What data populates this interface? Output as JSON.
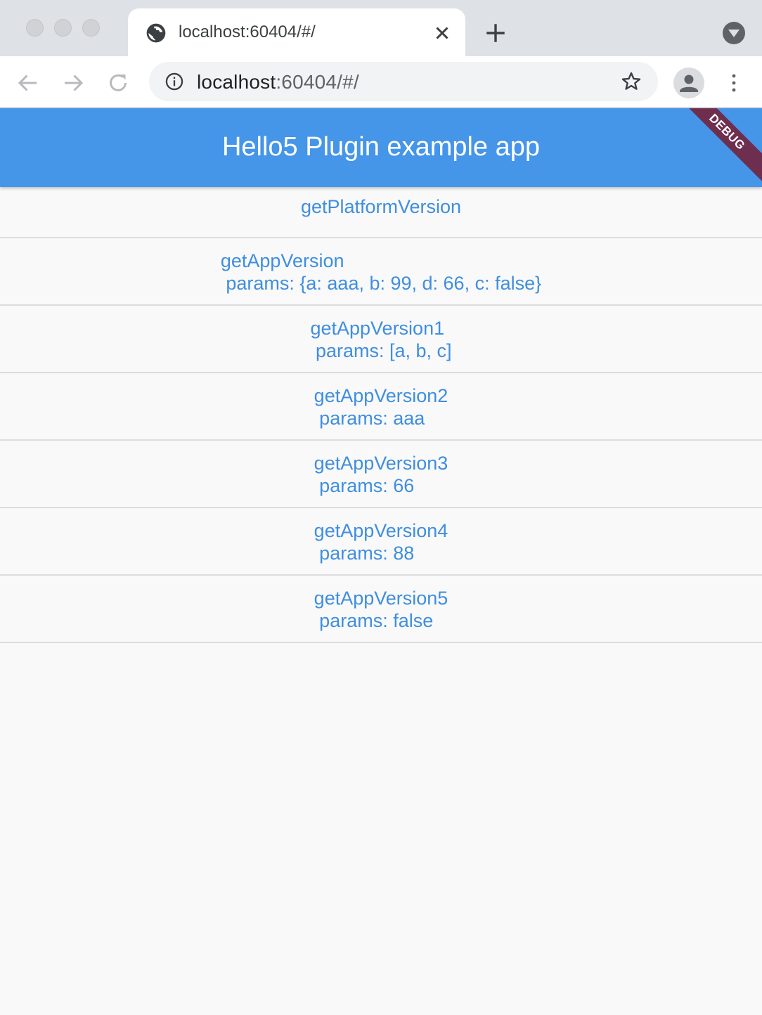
{
  "browser": {
    "tab": {
      "title": "localhost:60404/#/"
    },
    "address": {
      "host": "localhost",
      "rest": ":60404/#/"
    }
  },
  "app": {
    "title": "Hello5 Plugin example app",
    "debug_label": "DEBUG"
  },
  "items": [
    {
      "label": "getPlatformVersion"
    },
    {
      "label": "getAppVersion\n params: {a: aaa, b: 99, d: 66, c: false}"
    },
    {
      "label": "getAppVersion1\n params: [a, b, c]"
    },
    {
      "label": "getAppVersion2\n params: aaa"
    },
    {
      "label": "getAppVersion3\n params: 66"
    },
    {
      "label": "getAppVersion4\n params: 88"
    },
    {
      "label": "getAppVersion5\n params: false"
    }
  ],
  "colors": {
    "appbar": "#4595e9",
    "link": "#3f8ee0",
    "background": "#f9f9f9"
  }
}
